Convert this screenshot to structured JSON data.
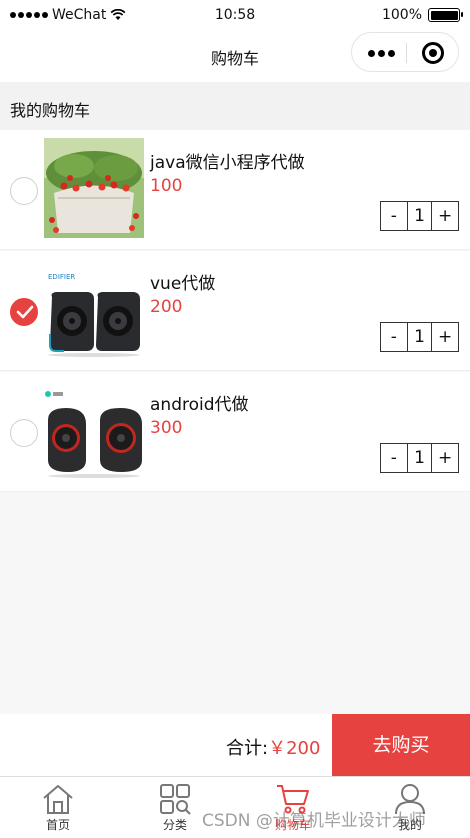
{
  "status_bar": {
    "carrier": "WeChat",
    "time": "10:58",
    "battery": "100%"
  },
  "nav": {
    "title": "购物车"
  },
  "section": {
    "title": "我的购物车"
  },
  "cart": {
    "items": [
      {
        "name": "java微信小程序代做",
        "price": "100",
        "qty": "1",
        "checked": false,
        "image": "strawberry-plant"
      },
      {
        "name": "vue代做",
        "price": "200",
        "qty": "1",
        "checked": true,
        "image": "edifier-speakers"
      },
      {
        "name": "android代做",
        "price": "300",
        "qty": "1",
        "checked": false,
        "image": "round-speakers"
      }
    ],
    "minus": "-",
    "plus": "+"
  },
  "footer": {
    "total_label": "合计:",
    "total_value": "￥200",
    "buy_label": "去购买"
  },
  "tabbar": {
    "tabs": [
      {
        "label": "首页",
        "icon": "home-icon"
      },
      {
        "label": "分类",
        "icon": "category-icon"
      },
      {
        "label": "购物车",
        "icon": "cart-icon",
        "active": true
      },
      {
        "label": "我的",
        "icon": "user-icon"
      }
    ]
  },
  "thumb_brand": "EDIFIER",
  "watermark": "CSDN @计算机毕业设计大师",
  "colors": {
    "accent": "#e64340",
    "background": "#f7f7f7"
  }
}
